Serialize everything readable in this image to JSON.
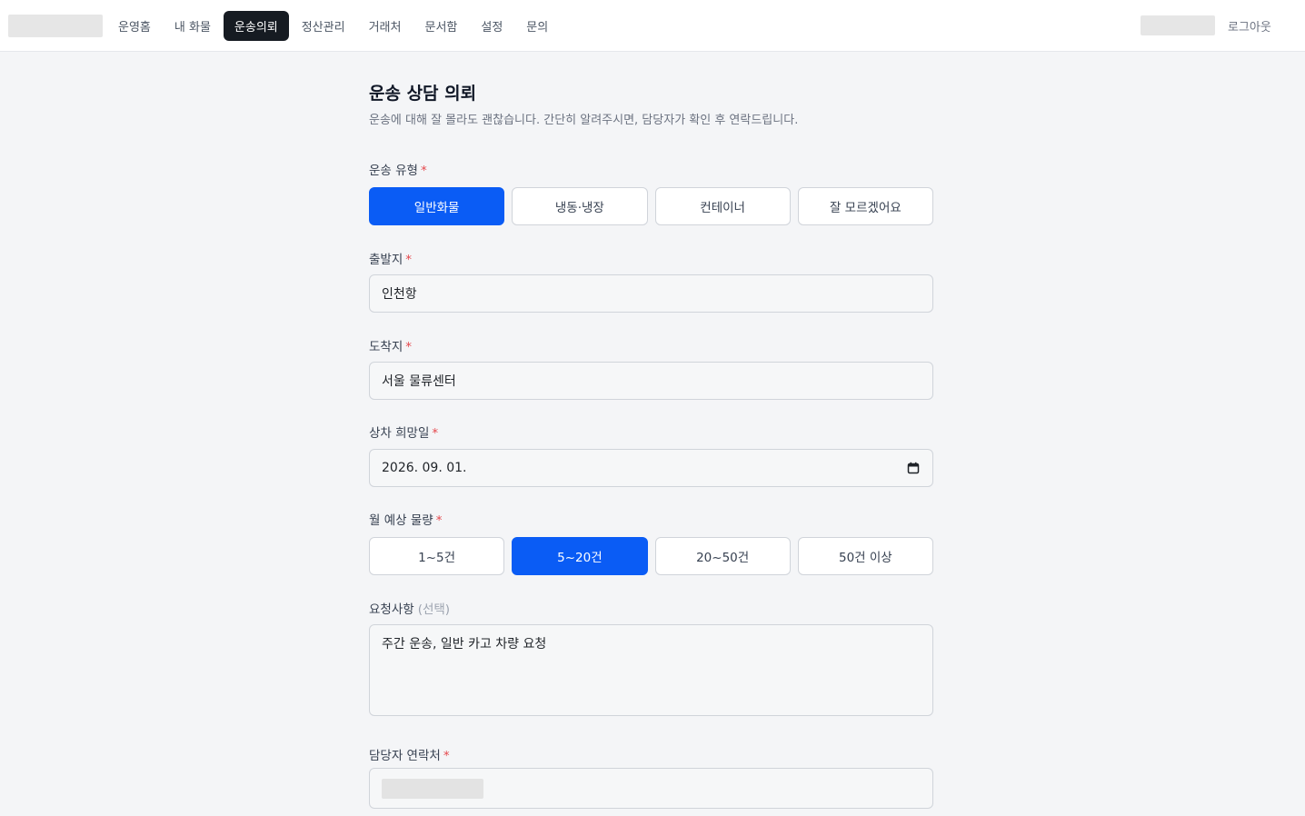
{
  "nav": {
    "items": [
      {
        "label": "운영홈",
        "active": false
      },
      {
        "label": "내 화물",
        "active": false
      },
      {
        "label": "운송의뢰",
        "active": true
      },
      {
        "label": "정산관리",
        "active": false
      },
      {
        "label": "거래처",
        "active": false
      },
      {
        "label": "문서함",
        "active": false
      },
      {
        "label": "설정",
        "active": false
      },
      {
        "label": "문의",
        "active": false
      }
    ],
    "logout_label": "로그아웃"
  },
  "page": {
    "title": "운송 상담 의뢰",
    "description": "운송에 대해 잘 몰라도 괜찮습니다. 간단히 알려주시면, 담당자가 확인 후 연락드립니다."
  },
  "form": {
    "required_mark": "*",
    "transport_type": {
      "label": "운송 유형",
      "options": [
        "일반화물",
        "냉동·냉장",
        "컨테이너",
        "잘 모르겠어요"
      ],
      "selected": "일반화물"
    },
    "origin": {
      "label": "출발지",
      "value": "인천항"
    },
    "destination": {
      "label": "도착지",
      "value": "서울 물류센터"
    },
    "pickup_date": {
      "label": "상차 희망일",
      "value": "2026. 09. 01."
    },
    "monthly_volume": {
      "label": "월 예상 물량",
      "options": [
        "1~5건",
        "5~20건",
        "20~50건",
        "50건 이상"
      ],
      "selected": "5~20건"
    },
    "requests": {
      "label": "요청사항",
      "optional_tag": "(선택)",
      "value": "주간 운송, 일반 카고 차량 요청"
    },
    "contact": {
      "label": "담당자 연락처"
    }
  },
  "colors": {
    "accent": "#0a5cf5",
    "nav_active_bg": "#161b22",
    "required": "#e5484d",
    "page_bg": "#f4f5f7"
  },
  "icons": {
    "date_picker": "calendar-icon"
  }
}
